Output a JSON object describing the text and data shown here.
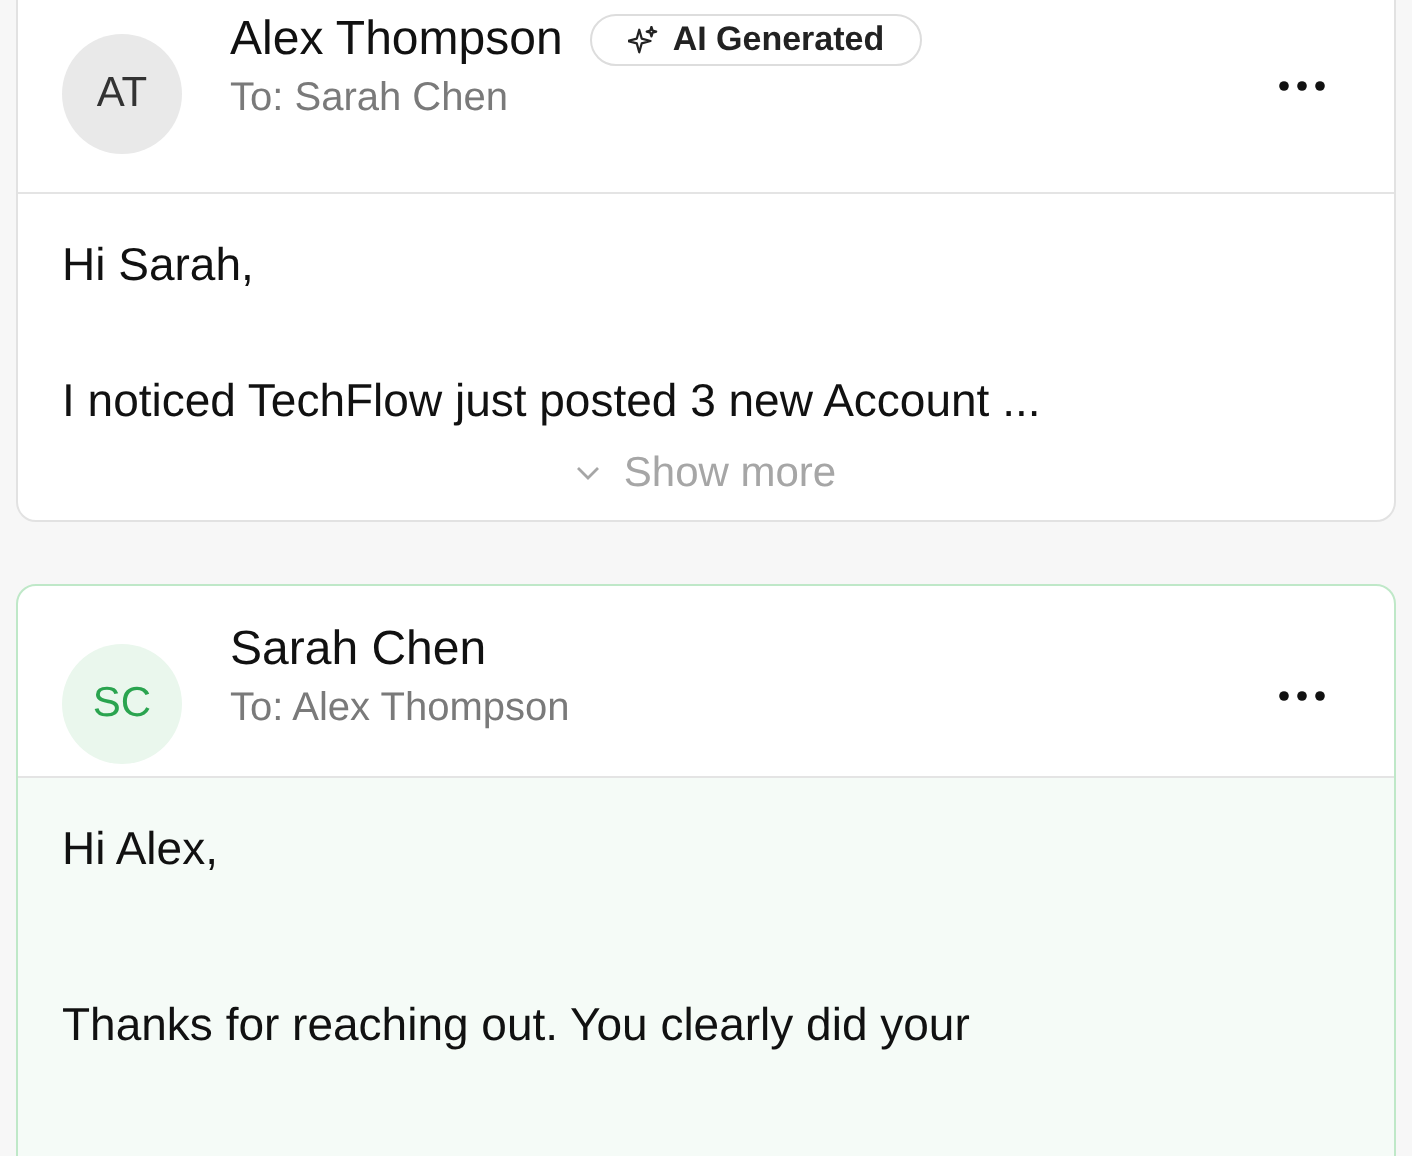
{
  "messages": [
    {
      "initials": "AT",
      "sender": "Alex Thompson",
      "badge": "AI Generated",
      "recipient": "To: Sarah Chen",
      "highlighted": false,
      "paragraphs": [
        "Hi Sarah,",
        "I noticed TechFlow just posted 3 new Account ..."
      ],
      "show_more": "Show more"
    },
    {
      "initials": "SC",
      "sender": "Sarah Chen",
      "recipient": "To: Alex Thompson",
      "highlighted": true,
      "paragraphs": [
        "Hi Alex,",
        "Thanks for reaching out. You clearly did your"
      ]
    }
  ]
}
